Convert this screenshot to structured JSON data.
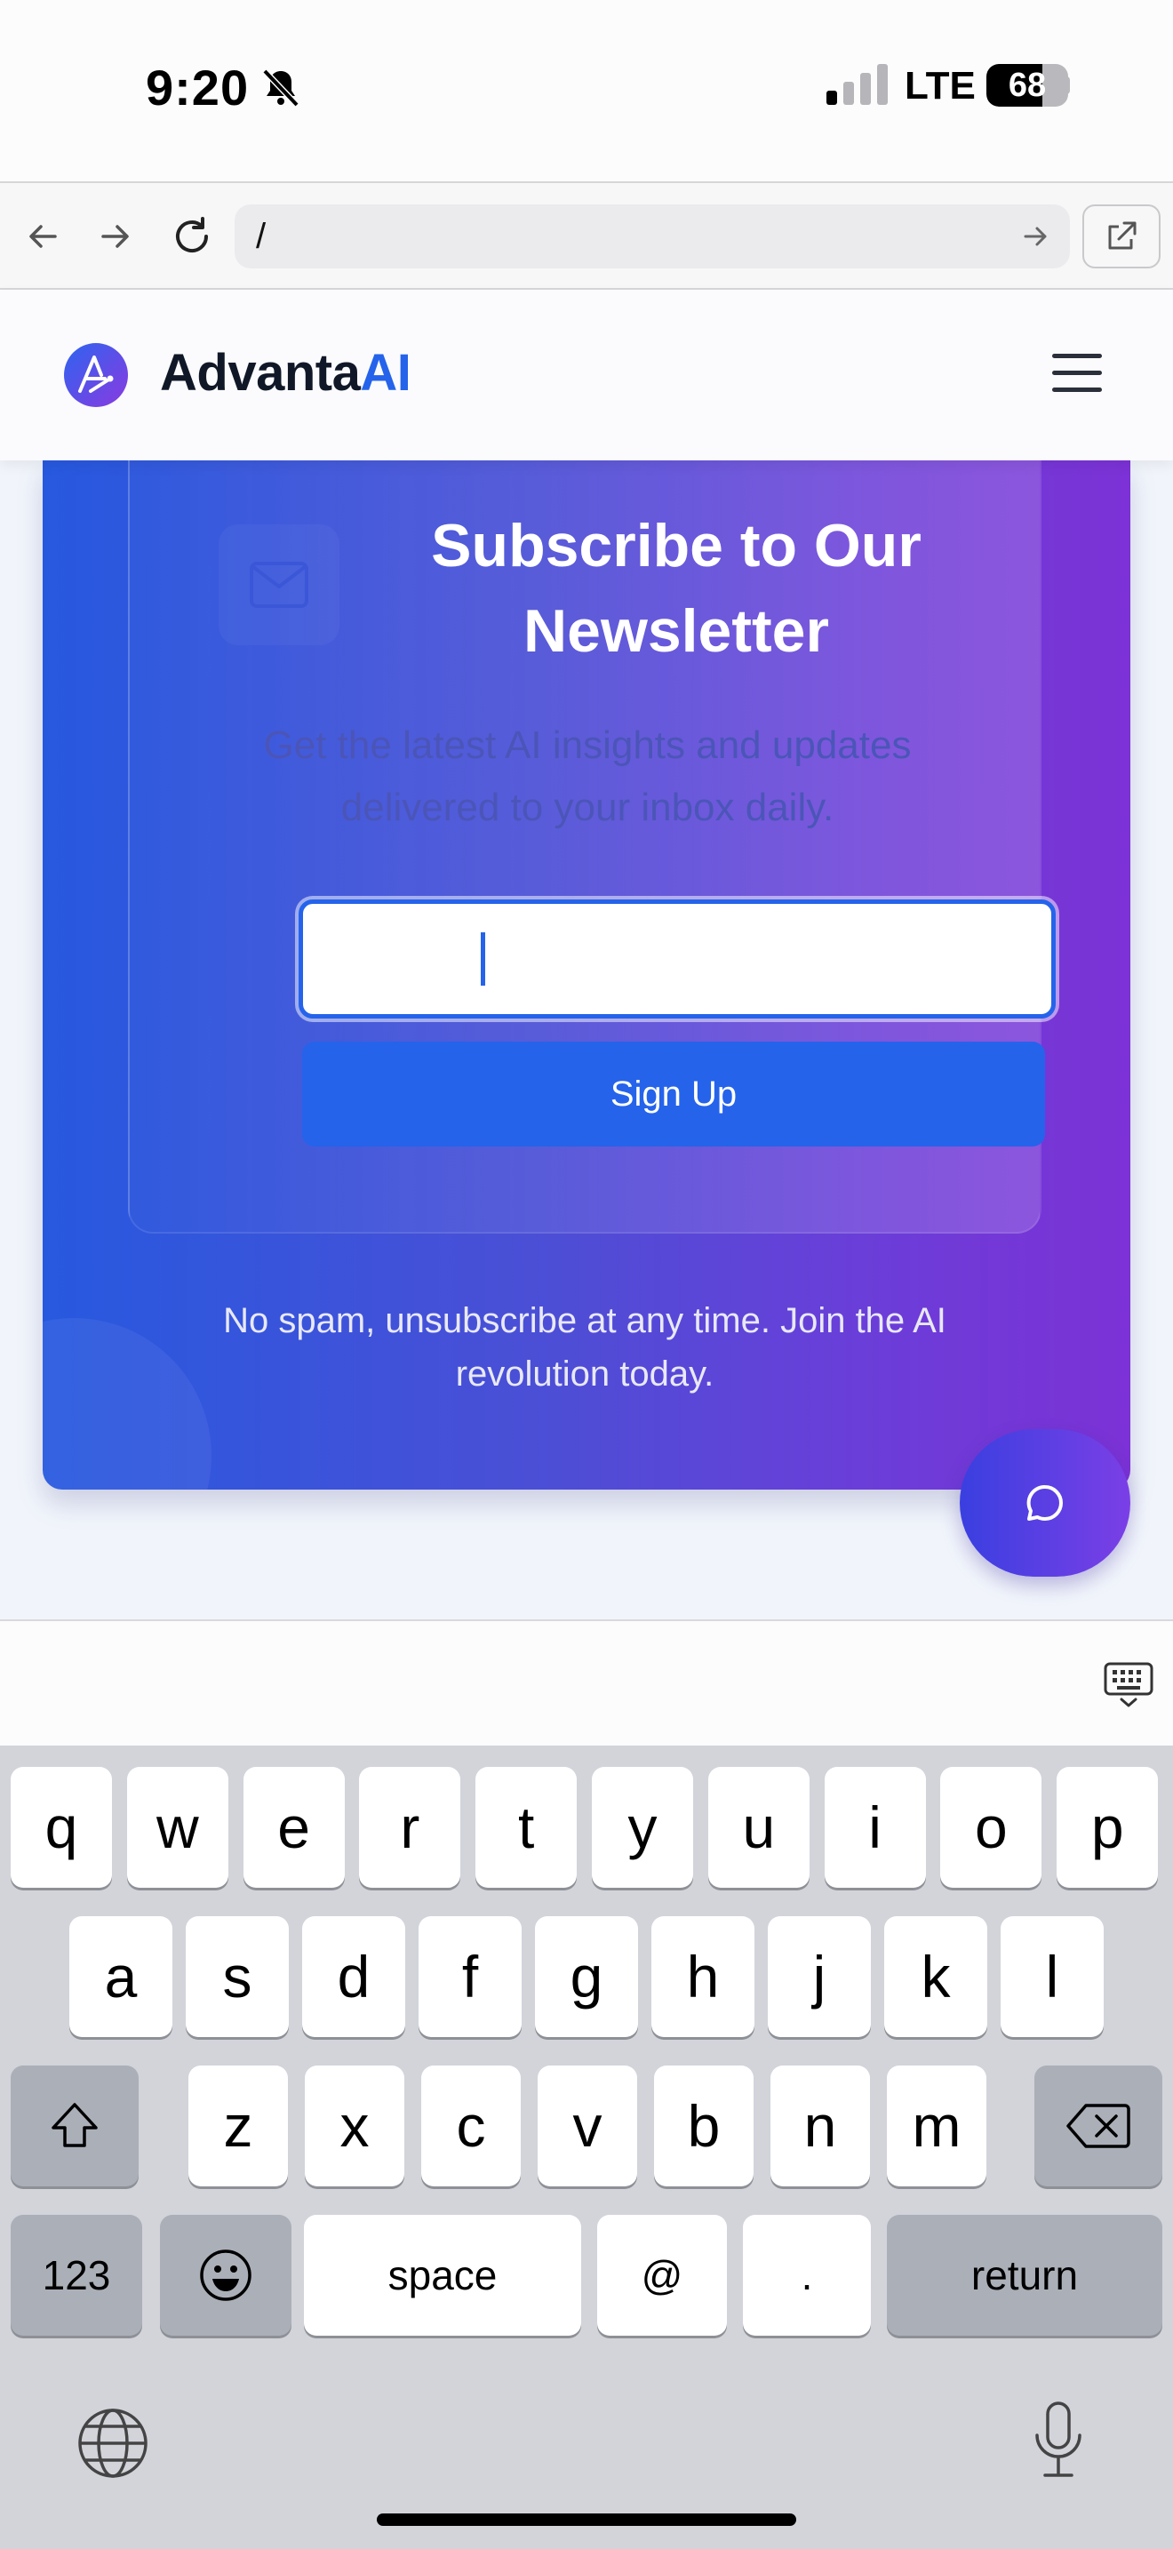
{
  "status_bar": {
    "time": "9:20",
    "network": "LTE",
    "battery": "68",
    "battery_level": 0.68
  },
  "browser": {
    "url": "/"
  },
  "header": {
    "brand_main": "Advanta",
    "brand_accent": "AI"
  },
  "newsletter": {
    "title": "Subscribe to Our Newsletter",
    "subtitle": "Get the latest AI insights and updates delivered to your inbox daily.",
    "email_value": "",
    "button_label": "Sign Up",
    "fine_print": "No spam, unsubscribe at any time. Join the AI revolution today."
  },
  "keyboard": {
    "row1": [
      "q",
      "w",
      "e",
      "r",
      "t",
      "y",
      "u",
      "i",
      "o",
      "p"
    ],
    "row2": [
      "a",
      "s",
      "d",
      "f",
      "g",
      "h",
      "j",
      "k",
      "l"
    ],
    "row3": [
      "z",
      "x",
      "c",
      "v",
      "b",
      "n",
      "m"
    ],
    "numbers_key": "123",
    "space_key": "space",
    "at_key": "@",
    "dot_key": ".",
    "return_key": "return"
  },
  "colors": {
    "accent": "#2563eb",
    "gradient_start": "#2759df",
    "gradient_end": "#7c32d6"
  },
  "icons": [
    "bell-slash-icon",
    "signal-icon",
    "back-icon",
    "forward-icon",
    "reload-icon",
    "arrow-right-icon",
    "external-link-icon",
    "logo-icon",
    "menu-icon",
    "mail-icon",
    "chat-icon",
    "keyboard-dismiss-icon",
    "shift-icon",
    "backspace-icon",
    "emoji-icon",
    "globe-icon",
    "microphone-icon"
  ]
}
